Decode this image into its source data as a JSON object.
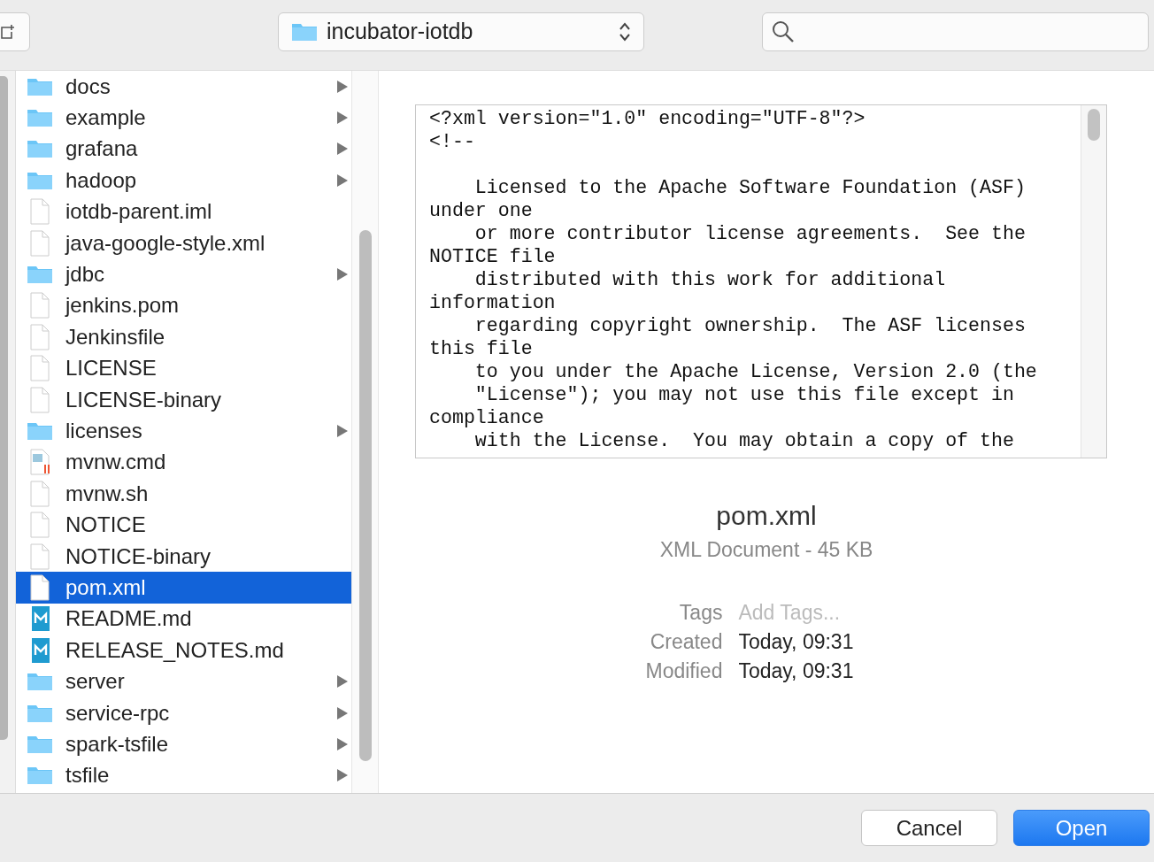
{
  "toolbar": {
    "location": "incubator-iotdb"
  },
  "files": [
    {
      "name": "docs",
      "kind": "folder",
      "selected": false
    },
    {
      "name": "example",
      "kind": "folder",
      "selected": false
    },
    {
      "name": "grafana",
      "kind": "folder",
      "selected": false
    },
    {
      "name": "hadoop",
      "kind": "folder",
      "selected": false
    },
    {
      "name": "iotdb-parent.iml",
      "kind": "file",
      "selected": false
    },
    {
      "name": "java-google-style.xml",
      "kind": "file",
      "selected": false
    },
    {
      "name": "jdbc",
      "kind": "folder",
      "selected": false
    },
    {
      "name": "jenkins.pom",
      "kind": "file",
      "selected": false
    },
    {
      "name": "Jenkinsfile",
      "kind": "file",
      "selected": false
    },
    {
      "name": "LICENSE",
      "kind": "file",
      "selected": false
    },
    {
      "name": "LICENSE-binary",
      "kind": "file",
      "selected": false
    },
    {
      "name": "licenses",
      "kind": "folder",
      "selected": false
    },
    {
      "name": "mvnw.cmd",
      "kind": "script",
      "selected": false
    },
    {
      "name": "mvnw.sh",
      "kind": "file",
      "selected": false
    },
    {
      "name": "NOTICE",
      "kind": "file",
      "selected": false
    },
    {
      "name": "NOTICE-binary",
      "kind": "file",
      "selected": false
    },
    {
      "name": "pom.xml",
      "kind": "file",
      "selected": true
    },
    {
      "name": "README.md",
      "kind": "markdown",
      "selected": false
    },
    {
      "name": "RELEASE_NOTES.md",
      "kind": "markdown",
      "selected": false
    },
    {
      "name": "server",
      "kind": "folder",
      "selected": false
    },
    {
      "name": "service-rpc",
      "kind": "folder",
      "selected": false
    },
    {
      "name": "spark-tsfile",
      "kind": "folder",
      "selected": false
    },
    {
      "name": "tsfile",
      "kind": "folder",
      "selected": false
    }
  ],
  "preview": {
    "text": "<?xml version=\"1.0\" encoding=\"UTF-8\"?>\n<!--\n\n    Licensed to the Apache Software Foundation (ASF)\nunder one\n    or more contributor license agreements.  See the\nNOTICE file\n    distributed with this work for additional\ninformation\n    regarding copyright ownership.  The ASF licenses\nthis file\n    to you under the Apache License, Version 2.0 (the\n    \"License\"); you may not use this file except in\ncompliance\n    with the License.  You may obtain a copy of the",
    "filename": "pom.xml",
    "kind_size": "XML Document - 45 KB",
    "meta": [
      {
        "label": "Tags",
        "placeholder": "Add Tags..."
      },
      {
        "label": "Created",
        "value": "Today, 09:31"
      },
      {
        "label": "Modified",
        "value": "Today, 09:31"
      }
    ]
  },
  "buttons": [
    {
      "label": "Cancel",
      "kind": "secondary"
    },
    {
      "label": "Open",
      "kind": "primary"
    }
  ]
}
